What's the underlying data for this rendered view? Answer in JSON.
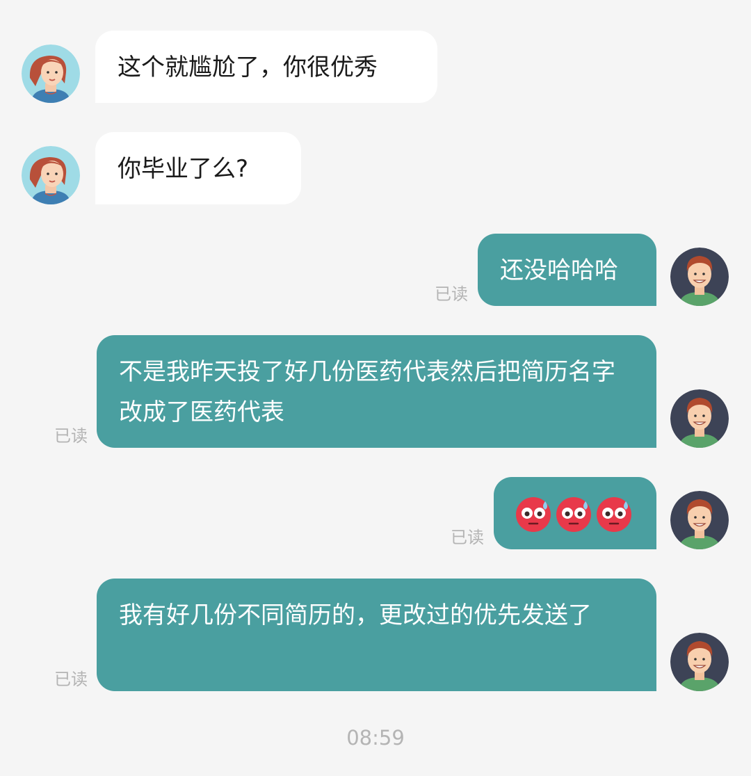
{
  "messages": [
    {
      "side": "in",
      "text": "这个就尴尬了，你很优秀"
    },
    {
      "side": "in",
      "text": "你毕业了么?"
    },
    {
      "side": "out",
      "text": "还没哈哈哈",
      "status": "已读"
    },
    {
      "side": "out",
      "text": "不是我昨天投了好几份医药代表然后把简历名字改成了医药代表",
      "status": "已读"
    },
    {
      "side": "out",
      "emoji": [
        "flushed-face-emoji",
        "flushed-face-emoji",
        "flushed-face-emoji"
      ],
      "status": "已读"
    },
    {
      "side": "out",
      "text": "我有好几份不同简历的，更改过的优先发送了",
      "status": "已读"
    }
  ],
  "timestamp": "08:59",
  "colors": {
    "background": "#f5f5f5",
    "incoming_bubble": "#ffffff",
    "outgoing_bubble": "#4a9fa0",
    "read_status": "#b4b4b4"
  },
  "icons": {
    "contact_avatar": "woman-avatar-icon",
    "self_avatar": "man-avatar-icon"
  }
}
